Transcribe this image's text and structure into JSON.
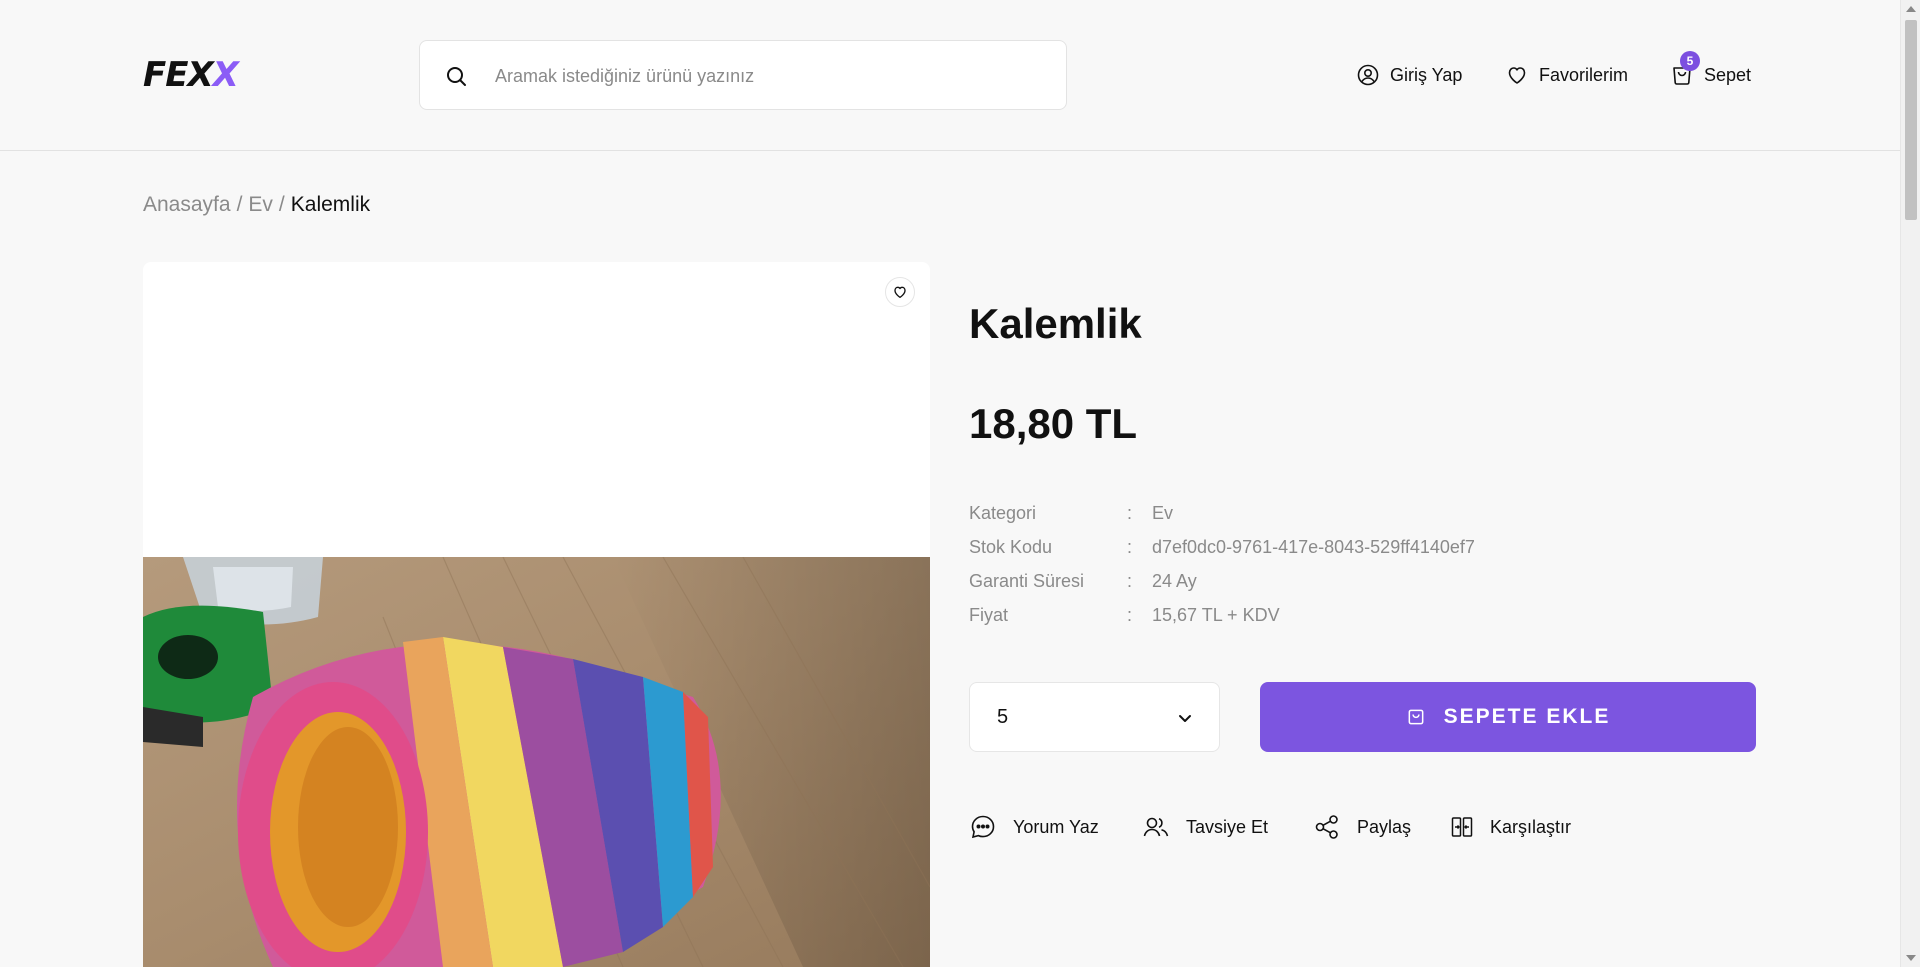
{
  "header": {
    "logo": {
      "part1": "FEX",
      "part2": "X"
    },
    "search": {
      "placeholder": "Aramak istediğiniz ürünü yazınız"
    },
    "login_label": "Giriş Yap",
    "favorites_label": "Favorilerim",
    "cart_label": "Sepet",
    "cart_count": "5"
  },
  "breadcrumb": {
    "items": [
      "Anasayfa",
      "Ev"
    ],
    "separator": "/",
    "current": "Kalemlik"
  },
  "product": {
    "title": "Kalemlik",
    "price": "18,80 TL",
    "specs": [
      {
        "label": "Kategori",
        "value": "Ev"
      },
      {
        "label": "Stok Kodu",
        "value": "d7ef0dc0-9761-417e-8043-529ff4140ef7"
      },
      {
        "label": "Garanti Süresi",
        "value": "24 Ay"
      },
      {
        "label": "Fiyat",
        "value": "15,67 TL + KDV"
      }
    ],
    "spec_colon": ":",
    "quantity": "5",
    "add_to_cart_label": "SEPETE EKLE",
    "actions": {
      "comment": "Yorum Yaz",
      "recommend": "Tavsiye Et",
      "share": "Paylaş",
      "compare": "Karşılaştır"
    }
  },
  "colors": {
    "accent": "#7c55e0",
    "badge": "#7c4fe0",
    "muted_text": "#8a8a8a"
  }
}
